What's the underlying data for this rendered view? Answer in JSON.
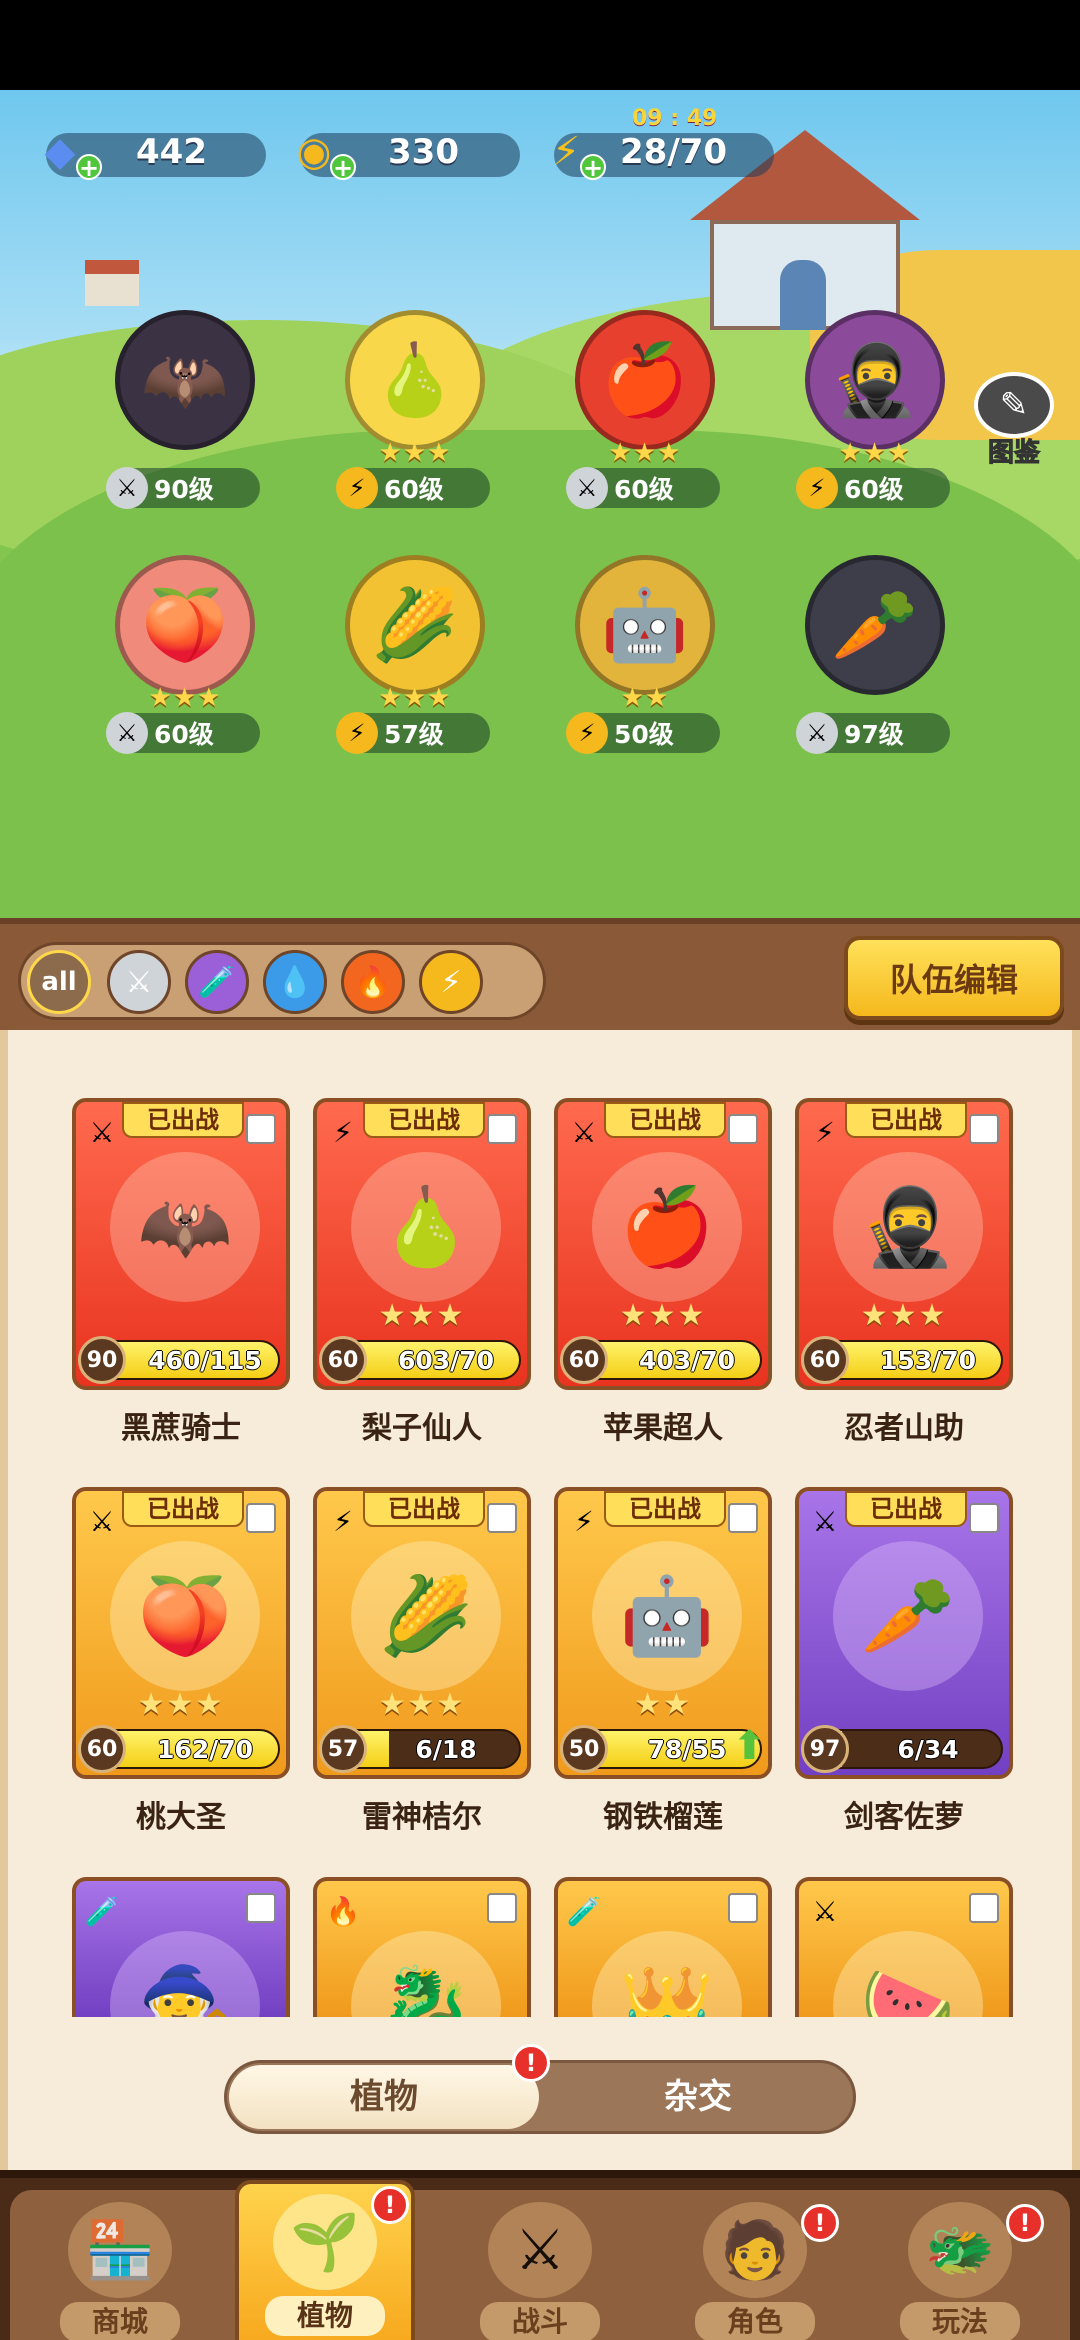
{
  "resources": {
    "gems": "442",
    "gold": "330",
    "energy": "28/70",
    "energy_timer": "09 : 49"
  },
  "codex_label": "图鉴",
  "heroes": [
    {
      "stars": "",
      "type_icon": "⚔",
      "level": "90级",
      "glyph": "🦇",
      "color": "#3b3344"
    },
    {
      "stars": "★★★",
      "type_icon": "⚡",
      "level": "60级",
      "glyph": "🍐",
      "color": "#f8d84a"
    },
    {
      "stars": "★★★",
      "type_icon": "⚔",
      "level": "60级",
      "glyph": "🍎",
      "color": "#e8402f"
    },
    {
      "stars": "★★★",
      "type_icon": "⚡",
      "level": "60级",
      "glyph": "🥷",
      "color": "#8b4a9a"
    },
    {
      "stars": "★★★",
      "type_icon": "⚔",
      "level": "60级",
      "glyph": "🍑",
      "color": "#f08a7a"
    },
    {
      "stars": "★★★",
      "type_icon": "⚡",
      "level": "57级",
      "glyph": "🌽",
      "color": "#f2c232"
    },
    {
      "stars": "★★",
      "type_icon": "⚡",
      "level": "50级",
      "glyph": "🤖",
      "color": "#e2b43c"
    },
    {
      "stars": "",
      "type_icon": "⚔",
      "level": "97级",
      "glyph": "🥕",
      "color": "#3d3e4a"
    }
  ],
  "filters": {
    "all": "all",
    "items": [
      "⚔",
      "🧪",
      "💧",
      "🔥",
      "⚡"
    ]
  },
  "team_edit_label": "队伍编辑",
  "cards": [
    {
      "name": "黑蔗骑士",
      "banner": "已出战",
      "level": "90",
      "progress": "460/115",
      "fill": 1.0,
      "stars": "",
      "theme": "red",
      "type_icon": "⚔",
      "glyph": "🦇",
      "upgrade": false
    },
    {
      "name": "梨子仙人",
      "banner": "已出战",
      "level": "60",
      "progress": "603/70",
      "fill": 1.0,
      "stars": "★★★",
      "theme": "red",
      "type_icon": "⚡",
      "glyph": "🍐",
      "upgrade": false
    },
    {
      "name": "苹果超人",
      "banner": "已出战",
      "level": "60",
      "progress": "403/70",
      "fill": 1.0,
      "stars": "★★★",
      "theme": "red",
      "type_icon": "⚔",
      "glyph": "🍎",
      "upgrade": false
    },
    {
      "name": "忍者山助",
      "banner": "已出战",
      "level": "60",
      "progress": "153/70",
      "fill": 1.0,
      "stars": "★★★",
      "theme": "red",
      "type_icon": "⚡",
      "glyph": "🥷",
      "upgrade": false
    },
    {
      "name": "桃大圣",
      "banner": "已出战",
      "level": "60",
      "progress": "162/70",
      "fill": 1.0,
      "stars": "★★★",
      "theme": "gold",
      "type_icon": "⚔",
      "glyph": "🍑",
      "upgrade": false
    },
    {
      "name": "雷神桔尔",
      "banner": "已出战",
      "level": "57",
      "progress": "6/18",
      "fill": 0.33,
      "stars": "★★★",
      "theme": "gold",
      "type_icon": "⚡",
      "glyph": "🌽",
      "upgrade": false
    },
    {
      "name": "钢铁榴莲",
      "banner": "已出战",
      "level": "50",
      "progress": "78/55",
      "fill": 1.0,
      "stars": "★★",
      "theme": "gold",
      "type_icon": "⚡",
      "glyph": "🤖",
      "upgrade": true
    },
    {
      "name": "剑客佐萝",
      "banner": "已出战",
      "level": "97",
      "progress": "6/34",
      "fill": 0.18,
      "stars": "",
      "theme": "purple",
      "type_icon": "⚔",
      "glyph": "🥕",
      "upgrade": false
    }
  ],
  "partial_cards": [
    {
      "type_icon": "🧪",
      "theme": "purple",
      "glyph": "🧙"
    },
    {
      "type_icon": "🔥",
      "theme": "gold",
      "glyph": "🐉"
    },
    {
      "type_icon": "🧪",
      "theme": "gold",
      "glyph": "👑"
    },
    {
      "type_icon": "⚔",
      "theme": "gold",
      "glyph": "🍉"
    }
  ],
  "toggle": {
    "left": "植物",
    "right": "杂交",
    "badge": "!"
  },
  "nav": [
    {
      "label": "商城",
      "glyph": "🏪",
      "badge": ""
    },
    {
      "label": "植物",
      "glyph": "🌱",
      "badge": "!"
    },
    {
      "label": "战斗",
      "glyph": "⚔",
      "badge": ""
    },
    {
      "label": "角色",
      "glyph": "🧑",
      "badge": "!"
    },
    {
      "label": "玩法",
      "glyph": "🐲",
      "badge": "!"
    }
  ],
  "colors": {
    "accent": "#f5b81d",
    "wood": "#8a5a38",
    "panel": "#f6ecd9",
    "alert": "#e8302b"
  }
}
